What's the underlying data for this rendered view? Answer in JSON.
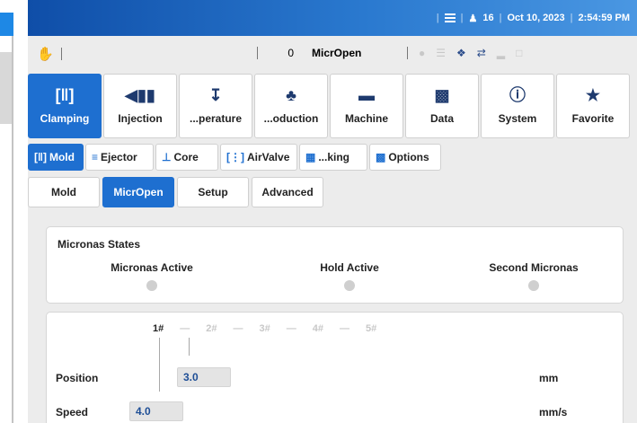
{
  "status_bar": {
    "user_count": "16",
    "date": "Oct 10, 2023",
    "time": "2:54:59 PM"
  },
  "toolbar": {
    "counter": "0",
    "active_page": "MicrOpen"
  },
  "main_tabs": [
    {
      "label": "Clamping",
      "icon": "clamp-icon"
    },
    {
      "label": "Injection",
      "icon": "injection-icon"
    },
    {
      "label": "...perature",
      "icon": "thermometer-icon"
    },
    {
      "label": "...oduction",
      "icon": "production-icon"
    },
    {
      "label": "Machine",
      "icon": "machine-icon"
    },
    {
      "label": "Data",
      "icon": "folder-icon"
    },
    {
      "label": "System",
      "icon": "info-icon"
    },
    {
      "label": "Favorite",
      "icon": "star-icon"
    }
  ],
  "sub_tabs": [
    {
      "label": "Mold",
      "icon": "mold-icon"
    },
    {
      "label": "Ejector",
      "icon": "ejector-icon"
    },
    {
      "label": "Core",
      "icon": "core-icon"
    },
    {
      "label": "AirValve",
      "icon": "air-valve-icon"
    },
    {
      "label": "...king",
      "icon": "parking-icon"
    },
    {
      "label": "Options",
      "icon": "options-icon"
    }
  ],
  "page_tabs": [
    "Mold",
    "MicrOpen",
    "Setup",
    "Advanced"
  ],
  "states_panel": {
    "title": "Micronas States",
    "items": [
      "Micronas Active",
      "Hold Active",
      "Second Micronas"
    ]
  },
  "params_panel": {
    "steps": [
      "1#",
      "2#",
      "3#",
      "4#",
      "5#"
    ],
    "position_label": "Position",
    "position_value": "3.0",
    "position_unit": "mm",
    "speed_label": "Speed",
    "speed_value": "4.0",
    "speed_unit": "mm/s"
  },
  "colors": {
    "accent": "#1e6fd0",
    "header_start": "#0f4ea8",
    "header_end": "#4a97e2",
    "led_off": "#cfcfcf"
  }
}
